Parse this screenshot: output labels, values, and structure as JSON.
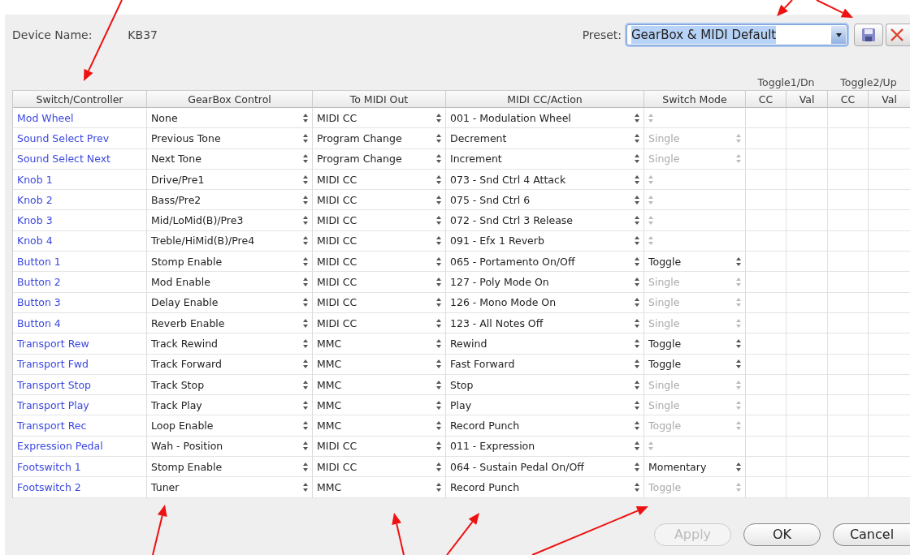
{
  "device_name": {
    "label": "Device Name:",
    "value": "KB37"
  },
  "preset": {
    "label": "Preset:",
    "value": "GearBox & MIDI Default",
    "text_selected": true
  },
  "table": {
    "column_groups": [
      {
        "label": "Toggle1/Dn"
      },
      {
        "label": "Toggle2/Up"
      }
    ],
    "columns": [
      "Switch/Controller",
      "GearBox Control",
      "To MIDI Out",
      "MIDI CC/Action",
      "Switch Mode",
      "CC",
      "Val",
      "CC",
      "Val"
    ],
    "rows": [
      {
        "controller": "Mod Wheel",
        "gearbox_control": "None",
        "midi_out": "MIDI CC",
        "action": "001 - Modulation Wheel",
        "switch_mode": {
          "enabled": false
        }
      },
      {
        "controller": "Sound Select Prev",
        "gearbox_control": "Previous Tone",
        "midi_out": "Program Change",
        "action": "Decrement",
        "switch_mode": {
          "value": "Single",
          "enabled": false
        }
      },
      {
        "controller": "Sound Select Next",
        "gearbox_control": "Next Tone",
        "midi_out": "Program Change",
        "action": "Increment",
        "switch_mode": {
          "value": "Single",
          "enabled": false
        }
      },
      {
        "controller": "Knob 1",
        "gearbox_control": "Drive/Pre1",
        "midi_out": "MIDI CC",
        "action": "073 - Snd Ctrl 4 Attack",
        "switch_mode": {
          "enabled": false
        }
      },
      {
        "controller": "Knob 2",
        "gearbox_control": "Bass/Pre2",
        "midi_out": "MIDI CC",
        "action": "075 - Snd Ctrl 6",
        "switch_mode": {
          "enabled": false
        }
      },
      {
        "controller": "Knob 3",
        "gearbox_control": "Mid/LoMid(B)/Pre3",
        "midi_out": "MIDI CC",
        "action": "072 - Snd Ctrl 3 Release",
        "switch_mode": {
          "enabled": false
        }
      },
      {
        "controller": "Knob 4",
        "gearbox_control": "Treble/HiMid(B)/Pre4",
        "midi_out": "MIDI CC",
        "action": "091 - Efx 1 Reverb",
        "switch_mode": {
          "enabled": false
        }
      },
      {
        "controller": "Button 1",
        "gearbox_control": "Stomp Enable",
        "midi_out": "MIDI CC",
        "action": "065 - Portamento On/Off",
        "switch_mode": {
          "value": "Toggle",
          "enabled": true
        }
      },
      {
        "controller": "Button 2",
        "gearbox_control": "Mod Enable",
        "midi_out": "MIDI CC",
        "action": "127 - Poly Mode On",
        "switch_mode": {
          "value": "Single",
          "enabled": false
        }
      },
      {
        "controller": "Button 3",
        "gearbox_control": "Delay Enable",
        "midi_out": "MIDI CC",
        "action": "126 - Mono Mode On",
        "switch_mode": {
          "value": "Single",
          "enabled": false
        }
      },
      {
        "controller": "Button 4",
        "gearbox_control": "Reverb Enable",
        "midi_out": "MIDI CC",
        "action": "123 - All Notes Off",
        "switch_mode": {
          "value": "Single",
          "enabled": false
        }
      },
      {
        "controller": "Transport Rew",
        "gearbox_control": "Track Rewind",
        "midi_out": "MMC",
        "action": "Rewind",
        "switch_mode": {
          "value": "Toggle",
          "enabled": true
        }
      },
      {
        "controller": "Transport Fwd",
        "gearbox_control": "Track Forward",
        "midi_out": "MMC",
        "action": "Fast Forward",
        "switch_mode": {
          "value": "Toggle",
          "enabled": true
        }
      },
      {
        "controller": "Transport Stop",
        "gearbox_control": "Track Stop",
        "midi_out": "MMC",
        "action": "Stop",
        "switch_mode": {
          "value": "Single",
          "enabled": false
        }
      },
      {
        "controller": "Transport Play",
        "gearbox_control": "Track Play",
        "midi_out": "MMC",
        "action": "Play",
        "switch_mode": {
          "value": "Single",
          "enabled": false
        }
      },
      {
        "controller": "Transport Rec",
        "gearbox_control": "Loop Enable",
        "midi_out": "MMC",
        "action": "Record Punch",
        "switch_mode": {
          "value": "Toggle",
          "enabled": false
        }
      },
      {
        "controller": "Expression Pedal",
        "gearbox_control": "Wah - Position",
        "midi_out": "MIDI CC",
        "action": "011 - Expression",
        "switch_mode": {
          "enabled": false
        }
      },
      {
        "controller": "Footswitch 1",
        "gearbox_control": "Stomp Enable",
        "midi_out": "MIDI CC",
        "action": "064 - Sustain Pedal On/Off",
        "switch_mode": {
          "value": "Momentary",
          "enabled": true
        }
      },
      {
        "controller": "Footswitch 2",
        "gearbox_control": "Tuner",
        "midi_out": "MMC",
        "action": "Record Punch",
        "switch_mode": {
          "value": "Toggle",
          "enabled": false
        }
      }
    ]
  },
  "buttons": [
    {
      "label": "Apply",
      "disabled": true
    },
    {
      "label": "OK",
      "disabled": false
    },
    {
      "label": "Cancel",
      "disabled": false
    }
  ]
}
